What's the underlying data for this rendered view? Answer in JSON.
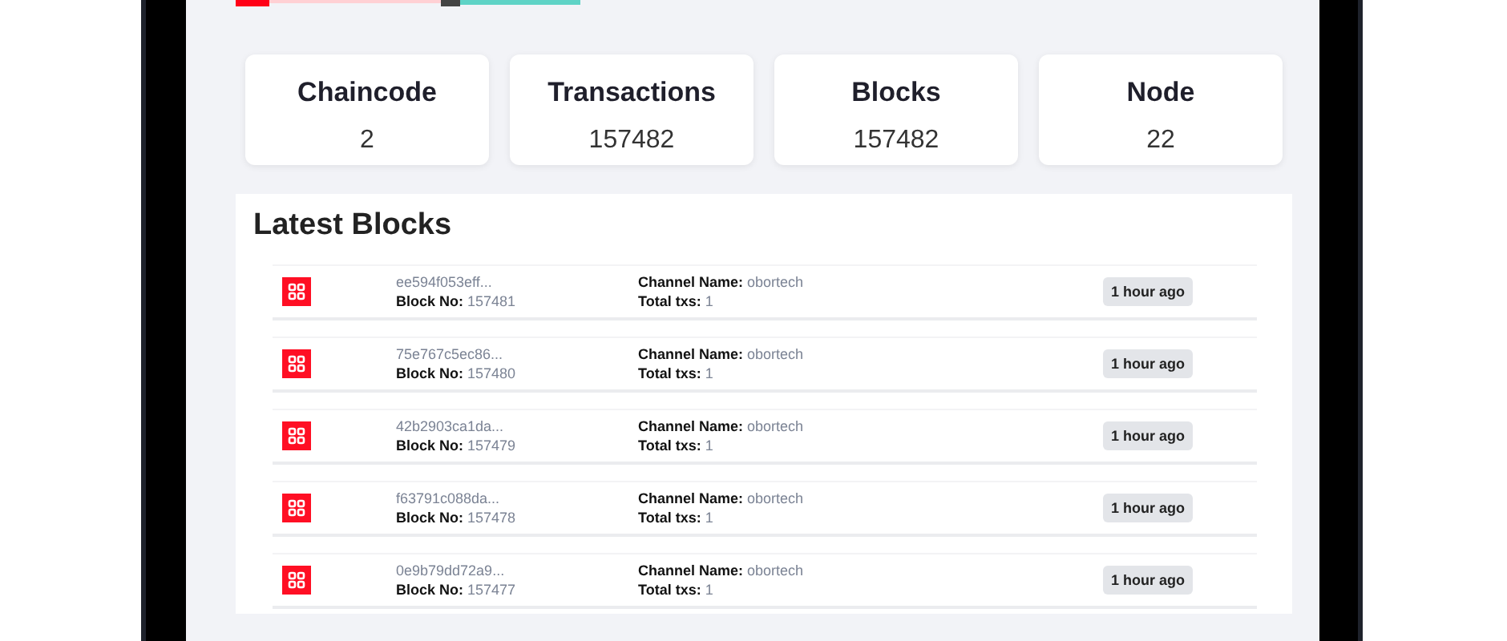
{
  "stats": [
    {
      "label": "Chaincode",
      "value": "2"
    },
    {
      "label": "Transactions",
      "value": "157482"
    },
    {
      "label": "Blocks",
      "value": "157482"
    },
    {
      "label": "Node",
      "value": "22"
    }
  ],
  "latest_blocks": {
    "title": "Latest Blocks",
    "rows": [
      {
        "hash": "ee594f053eff...",
        "block_no_label": "Block No:",
        "block_no": "157481",
        "channel_label": "Channel Name:",
        "channel": "obortech",
        "txs_label": "Total txs:",
        "txs": "1",
        "time": "1 hour ago"
      },
      {
        "hash": "75e767c5ec86...",
        "block_no_label": "Block No:",
        "block_no": "157480",
        "channel_label": "Channel Name:",
        "channel": "obortech",
        "txs_label": "Total txs:",
        "txs": "1",
        "time": "1 hour ago"
      },
      {
        "hash": "42b2903ca1da...",
        "block_no_label": "Block No:",
        "block_no": "157479",
        "channel_label": "Channel Name:",
        "channel": "obortech",
        "txs_label": "Total txs:",
        "txs": "1",
        "time": "1 hour ago"
      },
      {
        "hash": "f63791c088da...",
        "block_no_label": "Block No:",
        "block_no": "157478",
        "channel_label": "Channel Name:",
        "channel": "obortech",
        "txs_label": "Total txs:",
        "txs": "1",
        "time": "1 hour ago"
      },
      {
        "hash": "0e9b79dd72a9...",
        "block_no_label": "Block No:",
        "block_no": "157477",
        "channel_label": "Channel Name:",
        "channel": "obortech",
        "txs_label": "Total txs:",
        "txs": "1",
        "time": "1 hour ago"
      }
    ]
  }
}
